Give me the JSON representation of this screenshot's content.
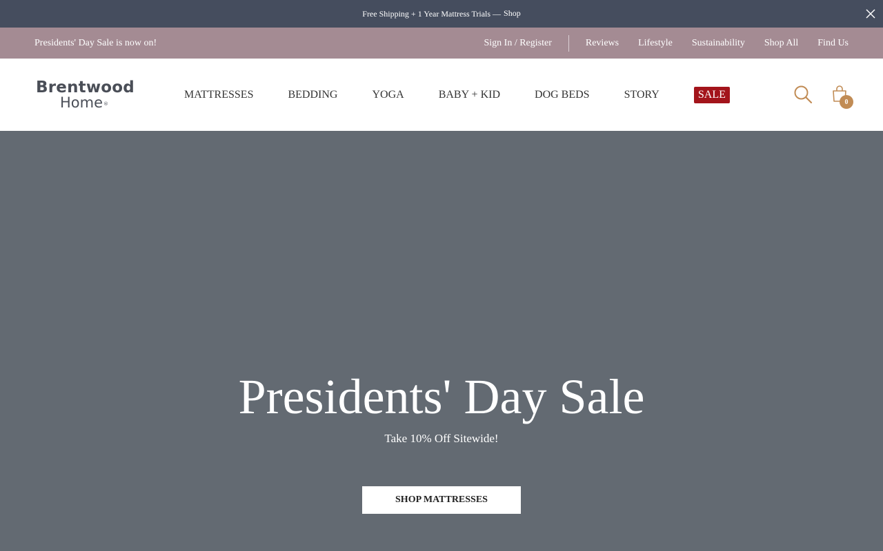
{
  "announcement": {
    "text": "Free Shipping + 1 Year Mattress Trials —",
    "link": "Shop"
  },
  "utility": {
    "promo": "Presidents' Day Sale is now on!",
    "signin": "Sign In / Register",
    "links": [
      "Reviews",
      "Lifestyle",
      "Sustainability",
      "Shop All",
      "Find Us"
    ]
  },
  "logo": {
    "line1": "Brentwood",
    "line2": "Home",
    "mark": "®"
  },
  "nav": {
    "items": [
      "MATTRESSES",
      "BEDDING",
      "YOGA",
      "BABY + KID",
      "DOG BEDS",
      "STORY"
    ],
    "sale": "SALE"
  },
  "cart": {
    "count": "0"
  },
  "hero": {
    "title": "Presidents' Day Sale",
    "subtitle": "Take 10% Off Sitewide!",
    "button": "SHOP MATTRESSES"
  },
  "colors": {
    "announcement_bg": "#454d5e",
    "utility_bg": "#a48b93",
    "sale_badge": "#a3141b",
    "cart_badge": "#c18c55",
    "hero_bg": "#636a72"
  }
}
